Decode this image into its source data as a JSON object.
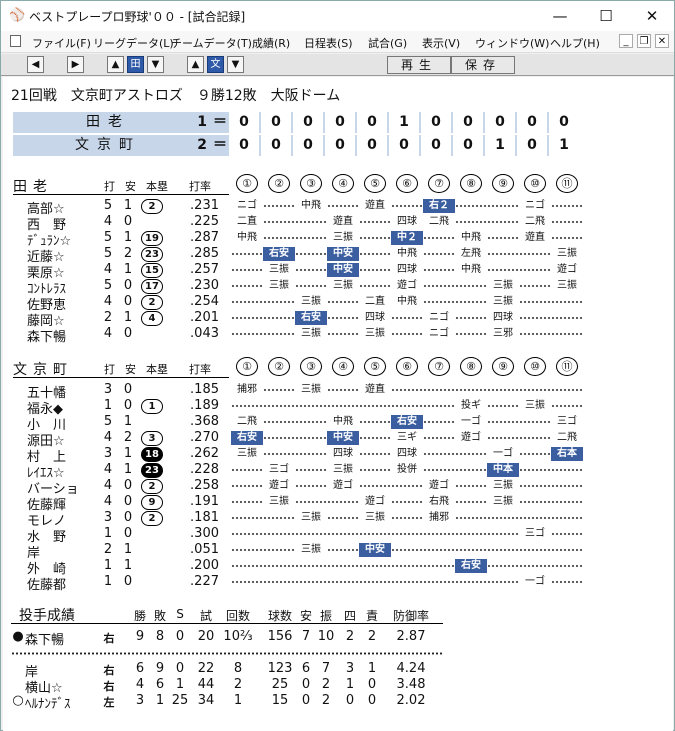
{
  "window": {
    "title": "ベストプレープロ野球'００ - [試合記録]",
    "icon": "baseball-cap-icon"
  },
  "menu": [
    "ファイル(F)",
    "リーグデータ(L)",
    "チームデータ(T)",
    "成績(R)",
    "日程表(S)",
    "試合(G)",
    "表示(V)",
    "ウィンドウ(W)",
    "ヘルプ(H)"
  ],
  "toolbar": {
    "team1_label": "田",
    "team2_label": "文",
    "play_label": "再生",
    "save_label": "保存"
  },
  "game_title": "21回戦　文京町アストロズ　９勝12敗　大阪ドーム",
  "scoreboard": [
    {
      "team": "田老",
      "total": "1",
      "eq": "＝",
      "innings": [
        "0",
        "0",
        "0",
        "0",
        "0",
        "1",
        "0",
        "0",
        "0",
        "0",
        "0"
      ]
    },
    {
      "team": "文京町",
      "total": "2",
      "eq": "＝",
      "innings": [
        "0",
        "0",
        "0",
        "0",
        "0",
        "0",
        "0",
        "0",
        "1",
        "0",
        "1"
      ]
    }
  ],
  "batting_headers": {
    "ab": "打",
    "h": "安",
    "hr": "本塁",
    "avg": "打率"
  },
  "innings_labels": [
    "①",
    "②",
    "③",
    "④",
    "⑤",
    "⑥",
    "⑦",
    "⑧",
    "⑨",
    "⑩",
    "⑪"
  ],
  "team1": {
    "name": "田老",
    "players": [
      {
        "name": "高部☆",
        "ab": "5",
        "h": "1",
        "hr": "2",
        "hr_filled": false,
        "avg": ".231",
        "res": [
          "ニゴ",
          "",
          "中飛",
          "",
          "遊直",
          "",
          "右２",
          "",
          "",
          "ニゴ",
          ""
        ],
        "hits": [
          6
        ]
      },
      {
        "name": "西　野",
        "ab": "4",
        "h": "0",
        "hr": "",
        "hr_filled": false,
        "avg": ".225",
        "res": [
          "二直",
          "",
          "",
          "遊直",
          "",
          "四球",
          "二飛",
          "",
          "",
          "二飛",
          ""
        ],
        "hits": []
      },
      {
        "name": "ﾃﾞｭﾗﾝ☆",
        "ab": "5",
        "h": "1",
        "hr": "19",
        "hr_filled": false,
        "avg": ".287",
        "res": [
          "中飛",
          "",
          "",
          "三振",
          "",
          "中２",
          "",
          "中飛",
          "",
          "遊直",
          ""
        ],
        "hits": [
          5
        ]
      },
      {
        "name": "近藤☆",
        "ab": "5",
        "h": "2",
        "hr": "23",
        "hr_filled": false,
        "avg": ".285",
        "res": [
          "",
          "右安",
          "",
          "中安",
          "",
          "中飛",
          "",
          "左飛",
          "",
          "",
          "三振"
        ],
        "hits": [
          1,
          3
        ]
      },
      {
        "name": "栗原☆",
        "ab": "4",
        "h": "1",
        "hr": "15",
        "hr_filled": false,
        "avg": ".257",
        "res": [
          "",
          "三振",
          "",
          "中安",
          "",
          "四球",
          "",
          "中飛",
          "",
          "",
          "遊ゴ"
        ],
        "hits": [
          3
        ]
      },
      {
        "name": "ｺﾝﾄﾚﾗｽ",
        "ab": "5",
        "h": "0",
        "hr": "17",
        "hr_filled": false,
        "avg": ".230",
        "res": [
          "",
          "三振",
          "",
          "三振",
          "",
          "遊ゴ",
          "",
          "",
          "三振",
          "",
          "三振"
        ],
        "hits": []
      },
      {
        "name": "佐野恵",
        "ab": "4",
        "h": "0",
        "hr": "2",
        "hr_filled": false,
        "avg": ".254",
        "res": [
          "",
          "",
          "三振",
          "",
          "二直",
          "中飛",
          "",
          "",
          "三振",
          "",
          ""
        ],
        "hits": []
      },
      {
        "name": "藤岡☆",
        "ab": "2",
        "h": "1",
        "hr": "4",
        "hr_filled": false,
        "avg": ".201",
        "res": [
          "",
          "",
          "右安",
          "",
          "四球",
          "",
          "ニゴ",
          "",
          "四球",
          "",
          ""
        ],
        "hits": [
          2
        ]
      },
      {
        "name": "森下暢",
        "ab": "4",
        "h": "0",
        "hr": "",
        "hr_filled": false,
        "avg": ".043",
        "res": [
          "",
          "",
          "三振",
          "",
          "三振",
          "",
          "ニゴ",
          "",
          "三邪",
          "",
          ""
        ],
        "hits": []
      }
    ]
  },
  "team2": {
    "name": "文京町",
    "players": [
      {
        "name": "五十幡",
        "ab": "3",
        "h": "0",
        "hr": "",
        "hr_filled": false,
        "avg": ".185",
        "res": [
          "捕邪",
          "",
          "三振",
          "",
          "遊直",
          "",
          "",
          "",
          "",
          "",
          ""
        ],
        "hits": []
      },
      {
        "name": "福永◆",
        "ab": "1",
        "h": "0",
        "hr": "1",
        "hr_filled": false,
        "avg": ".189",
        "res": [
          "",
          "",
          "",
          "",
          "",
          "",
          "",
          "投ギ",
          "",
          "三振",
          ""
        ],
        "hits": []
      },
      {
        "name": "小　川",
        "ab": "5",
        "h": "1",
        "hr": "",
        "hr_filled": false,
        "avg": ".368",
        "res": [
          "二飛",
          "",
          "",
          "中飛",
          "",
          "右安",
          "",
          "一ゴ",
          "",
          "",
          "三ゴ"
        ],
        "hits": [
          5
        ]
      },
      {
        "name": "源田☆",
        "ab": "4",
        "h": "2",
        "hr": "3",
        "hr_filled": false,
        "avg": ".270",
        "res": [
          "右安",
          "",
          "",
          "中安",
          "",
          "三ギ",
          "",
          "遊ゴ",
          "",
          "",
          "二飛"
        ],
        "hits": [
          0,
          3
        ]
      },
      {
        "name": "村　上",
        "ab": "3",
        "h": "1",
        "hr": "18",
        "hr_filled": true,
        "avg": ".262",
        "res": [
          "三振",
          "",
          "",
          "四球",
          "",
          "四球",
          "",
          "",
          "一ゴ",
          "",
          "右本"
        ],
        "hits": [
          10
        ]
      },
      {
        "name": "ﾚｲｴｽ☆",
        "ab": "4",
        "h": "1",
        "hr": "23",
        "hr_filled": true,
        "avg": ".228",
        "res": [
          "",
          "三ゴ",
          "",
          "三振",
          "",
          "投併",
          "",
          "",
          "中本",
          "",
          ""
        ],
        "hits": [
          8
        ]
      },
      {
        "name": "バーショ",
        "ab": "4",
        "h": "0",
        "hr": "2",
        "hr_filled": false,
        "avg": ".258",
        "res": [
          "",
          "遊ゴ",
          "",
          "遊ゴ",
          "",
          "",
          "遊ゴ",
          "",
          "三振",
          "",
          ""
        ],
        "hits": []
      },
      {
        "name": "佐藤輝",
        "ab": "4",
        "h": "0",
        "hr": "9",
        "hr_filled": false,
        "avg": ".191",
        "res": [
          "",
          "三振",
          "",
          "",
          "遊ゴ",
          "",
          "右飛",
          "",
          "三振",
          "",
          ""
        ],
        "hits": []
      },
      {
        "name": "モレノ",
        "ab": "3",
        "h": "0",
        "hr": "2",
        "hr_filled": false,
        "avg": ".181",
        "res": [
          "",
          "",
          "三振",
          "",
          "三振",
          "",
          "捕邪",
          "",
          "",
          "",
          ""
        ],
        "hits": []
      },
      {
        "name": "水　野",
        "ab": "1",
        "h": "0",
        "hr": "",
        "hr_filled": false,
        "avg": ".300",
        "res": [
          "",
          "",
          "",
          "",
          "",
          "",
          "",
          "",
          "",
          "三ゴ",
          ""
        ],
        "hits": []
      },
      {
        "name": "岸",
        "ab": "2",
        "h": "1",
        "hr": "",
        "hr_filled": false,
        "avg": ".051",
        "res": [
          "",
          "",
          "三振",
          "",
          "中安",
          "",
          "",
          "",
          "",
          "",
          ""
        ],
        "hits": [
          4
        ]
      },
      {
        "name": "外　崎",
        "ab": "1",
        "h": "1",
        "hr": "",
        "hr_filled": false,
        "avg": ".200",
        "res": [
          "",
          "",
          "",
          "",
          "",
          "",
          "",
          "右安",
          "",
          "",
          ""
        ],
        "hits": [
          7
        ]
      },
      {
        "name": "佐藤都",
        "ab": "1",
        "h": "0",
        "hr": "",
        "hr_filled": false,
        "avg": ".227",
        "res": [
          "",
          "",
          "",
          "",
          "",
          "",
          "",
          "",
          "",
          "一ゴ",
          ""
        ],
        "hits": []
      }
    ]
  },
  "pitching": {
    "title": "投手成績",
    "headers": [
      "勝",
      "敗",
      "S",
      "試",
      "回数",
      "球数",
      "安",
      "振",
      "四",
      "責",
      "防御率"
    ],
    "team1": [
      {
        "marker": "●",
        "name": "森下暢",
        "hand": "右",
        "w": "9",
        "l": "8",
        "s": "0",
        "g": "20",
        "ip": "10⅔",
        "pitches": "156",
        "h": "7",
        "k": "10",
        "bb": "2",
        "er": "2",
        "era": "2.87"
      }
    ],
    "team2": [
      {
        "marker": "",
        "name": "岸",
        "hand": "右",
        "w": "6",
        "l": "9",
        "s": "0",
        "g": "22",
        "ip": "8",
        "pitches": "123",
        "h": "6",
        "k": "7",
        "bb": "3",
        "er": "1",
        "era": "4.24"
      },
      {
        "marker": "",
        "name": "横山☆",
        "hand": "右",
        "w": "4",
        "l": "6",
        "s": "1",
        "g": "44",
        "ip": "2",
        "pitches": "25",
        "h": "0",
        "k": "2",
        "bb": "1",
        "er": "0",
        "era": "3.48"
      },
      {
        "marker": "○",
        "name": "ﾍﾙﾅﾝﾃﾞｽ",
        "hand": "左",
        "w": "3",
        "l": "1",
        "s": "25",
        "g": "34",
        "ip": "1",
        "pitches": "15",
        "h": "0",
        "k": "2",
        "bb": "0",
        "er": "0",
        "era": "2.02"
      }
    ]
  }
}
